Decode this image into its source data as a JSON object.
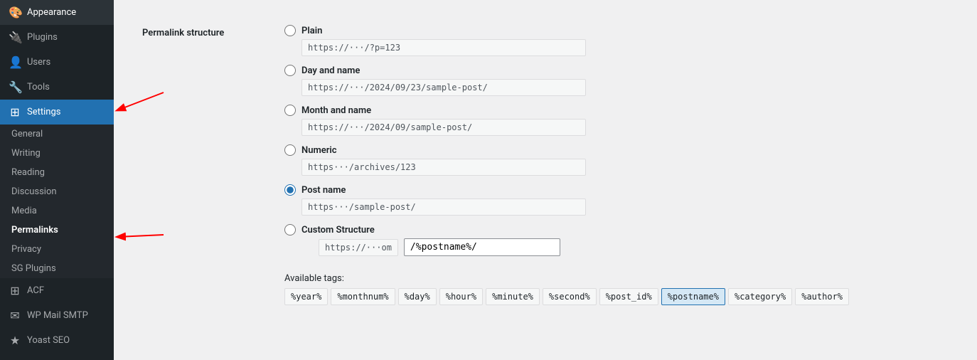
{
  "sidebar": {
    "items": [
      {
        "label": "Appearance",
        "icon": "🎨",
        "active": false
      },
      {
        "label": "Plugins",
        "icon": "🔌",
        "active": false
      },
      {
        "label": "Users",
        "icon": "👤",
        "active": false
      },
      {
        "label": "Tools",
        "icon": "🔧",
        "active": false
      },
      {
        "label": "Settings",
        "icon": "⊞",
        "active": true
      }
    ],
    "sub_items": [
      {
        "label": "General",
        "active": false
      },
      {
        "label": "Writing",
        "active": false
      },
      {
        "label": "Reading",
        "active": false
      },
      {
        "label": "Discussion",
        "active": false
      },
      {
        "label": "Media",
        "active": false
      },
      {
        "label": "Permalinks",
        "active": true
      },
      {
        "label": "Privacy",
        "active": false
      },
      {
        "label": "SG Plugins",
        "active": false
      }
    ],
    "bottom_items": [
      {
        "label": "ACF",
        "icon": "⊞"
      },
      {
        "label": "WP Mail SMTP",
        "icon": "✉"
      },
      {
        "label": "Yoast SEO",
        "icon": "★"
      }
    ]
  },
  "main": {
    "form_label": "Permalink structure",
    "options": [
      {
        "id": "plain",
        "label": "Plain",
        "checked": false,
        "example": "https://···/?p=123"
      },
      {
        "id": "day_name",
        "label": "Day and name",
        "checked": false,
        "example": "https://···/2024/09/23/sample-post/"
      },
      {
        "id": "month_name",
        "label": "Month and name",
        "checked": false,
        "example": "https://···/2024/09/sample-post/"
      },
      {
        "id": "numeric",
        "label": "Numeric",
        "checked": false,
        "example": "https···/archives/123"
      },
      {
        "id": "post_name",
        "label": "Post name",
        "checked": true,
        "example": "https···/sample-post/"
      },
      {
        "id": "custom",
        "label": "Custom Structure",
        "checked": false,
        "prefix": "https://···om",
        "value": "/%postname%/"
      }
    ],
    "available_tags_label": "Available tags:",
    "tags": [
      {
        "label": "%year%",
        "highlight": false
      },
      {
        "label": "%monthnum%",
        "highlight": false
      },
      {
        "label": "%day%",
        "highlight": false
      },
      {
        "label": "%hour%",
        "highlight": false
      },
      {
        "label": "%minute%",
        "highlight": false
      },
      {
        "label": "%second%",
        "highlight": false
      },
      {
        "label": "%post_id%",
        "highlight": false
      },
      {
        "label": "%postname%",
        "highlight": true
      },
      {
        "label": "%category%",
        "highlight": false
      },
      {
        "label": "%author%",
        "highlight": false
      }
    ]
  }
}
